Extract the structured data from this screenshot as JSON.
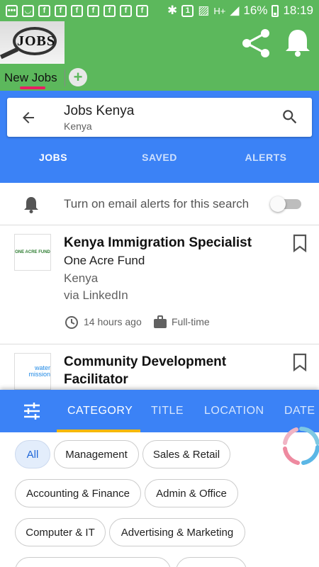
{
  "statusbar": {
    "battery": "16%",
    "time": "18:19",
    "signal_label": "H+",
    "sim_label": "1"
  },
  "appbar": {
    "logo_text": "JOBS",
    "tab_label": "New Jobs",
    "add_tab_label": "+"
  },
  "search": {
    "title": "Jobs Kenya",
    "location": "Kenya"
  },
  "tabs": [
    "JOBS",
    "SAVED",
    "ALERTS"
  ],
  "alert": {
    "text": "Turn on email alerts for this search",
    "enabled": false
  },
  "jobs": [
    {
      "title": "Kenya Immigration Specialist",
      "company": "One Acre Fund",
      "company_logo_text": "ONE ACRE FUND",
      "location": "Kenya",
      "via": "via LinkedIn",
      "posted": "14 hours ago",
      "type": "Full-time"
    },
    {
      "title": "Community Development Facilitator",
      "company_logo_text": "water mission"
    }
  ],
  "filter_tabs": [
    "CATEGORY",
    "TITLE",
    "LOCATION",
    "DATE POSTED"
  ],
  "categories": [
    {
      "label": "All",
      "selected": true
    },
    {
      "label": "Management",
      "selected": false
    },
    {
      "label": "Sales & Retail",
      "selected": false
    },
    {
      "label": "Accounting & Finance",
      "selected": false
    },
    {
      "label": "Admin & Office",
      "selected": false
    },
    {
      "label": "Computer & IT",
      "selected": false
    },
    {
      "label": "Advertising & Marketing",
      "selected": false
    }
  ],
  "colors": {
    "green": "#5cb85c",
    "blue": "#3b82f6",
    "pink_underline": "#e91e63",
    "yellow_underline": "#f5b800"
  }
}
